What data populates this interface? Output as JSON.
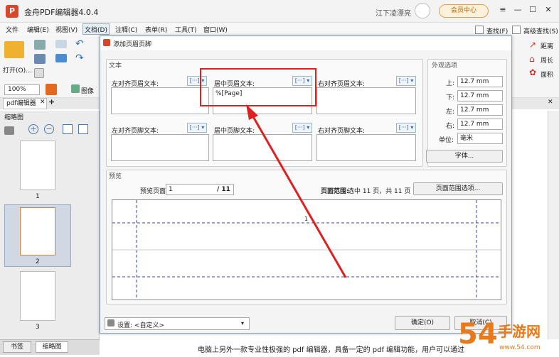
{
  "app": {
    "title": "金舟PDF编辑器4.0.4",
    "user": "江下凌漂亮",
    "member": "会员中心"
  },
  "menu": [
    "文件",
    "编辑(E)",
    "视图(V)",
    "文档(D)",
    "注释(C)",
    "表单(R)",
    "工具(T)",
    "窗口(W)"
  ],
  "toolbar": {
    "open": "打开(O)...",
    "zoom": "100%",
    "image": "图像",
    "find": "查找(F)",
    "adv_find": "高级查找(S)",
    "distance": "距离",
    "perimeter": "周长",
    "area": "面积"
  },
  "doc_tab": "pdf编辑器",
  "thumb": {
    "title": "缩略图",
    "pages": [
      "1",
      "2",
      "3"
    ],
    "tabs": [
      "书签",
      "缩略图"
    ]
  },
  "dialog": {
    "title": "添加页眉页脚",
    "text_group": "文本",
    "header_left_label": "左对齐页眉文本:",
    "header_center_label": "居中页眉文本:",
    "header_right_label": "右对齐页眉文本:",
    "header_center_value": "%[Page]",
    "footer_left_label": "左对齐页脚文本:",
    "footer_center_label": "居中页脚文本:",
    "footer_right_label": "右对齐页脚文本:",
    "appearance_group": "外观选项",
    "margins": [
      {
        "label": "上:",
        "value": "12.7 mm"
      },
      {
        "label": "下:",
        "value": "12.7 mm"
      },
      {
        "label": "左:",
        "value": "12.7 mm"
      },
      {
        "label": "右:",
        "value": "12.7 mm"
      }
    ],
    "unit_label": "单位:",
    "unit_value": "毫米",
    "font_btn": "字体...",
    "preview_group": "预览",
    "preview_page_label": "预览页面",
    "preview_page": "1",
    "preview_total": "/ 11",
    "page_range_label": "页面范围:",
    "page_range_value": "选中 11 页，共 11 页",
    "page_range_btn": "页面范围选项...",
    "preview_number": "1",
    "settings_label": "设置:",
    "settings_value": "<自定义>",
    "ok": "确定(O)",
    "cancel": "取消(C)"
  },
  "status_text": "电脑上另外一款专业性极强的 pdf 编辑器，具备一定的 pdf 编辑功能，用户可以通过",
  "watermark": {
    "text": "手游网",
    "number": "54",
    "url": "www.54.com"
  }
}
